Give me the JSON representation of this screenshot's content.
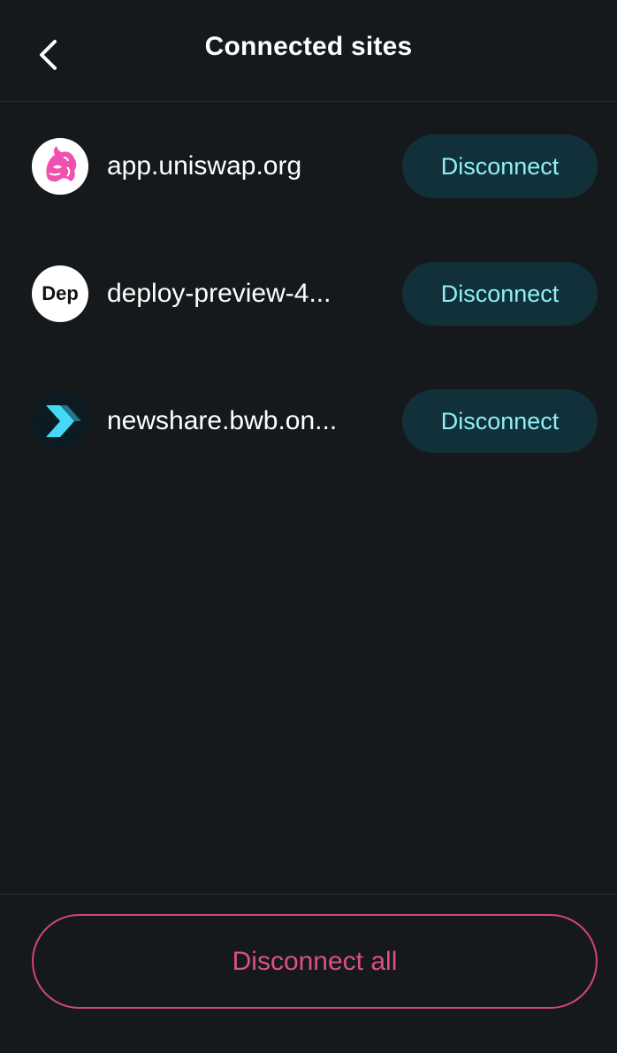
{
  "header": {
    "title": "Connected sites",
    "back_icon": "chevron-left-icon"
  },
  "sites": [
    {
      "name": "app.uniswap.org",
      "icon": "uniswap-unicorn-icon",
      "button_label": "Disconnect"
    },
    {
      "name": "deploy-preview-4...",
      "icon_text": "Dep",
      "button_label": "Disconnect"
    },
    {
      "name": "newshare.bwb.on...",
      "icon": "chevron-right-logo-icon",
      "button_label": "Disconnect"
    }
  ],
  "footer": {
    "disconnect_all_label": "Disconnect all"
  },
  "colors": {
    "background": "#16191b",
    "button_bg": "#12303a",
    "button_text": "#8ff0f7",
    "danger": "#d0457a",
    "uniswap_pink": "#f050b0",
    "newshare_cyan": "#44d9f5"
  }
}
